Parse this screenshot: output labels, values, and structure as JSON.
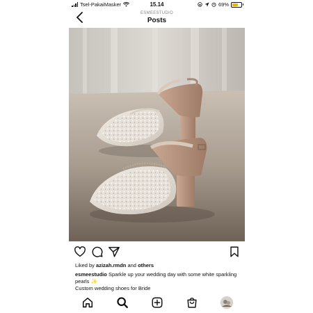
{
  "status_bar": {
    "carrier": "Tsel-PakaiMasker",
    "time": "15.14",
    "battery_percent": "69%",
    "battery_level": 0.69,
    "battery_color": "#f0b400"
  },
  "header": {
    "account": "ESMEESTUDIO",
    "title": "Posts",
    "back_icon": "chevron-left-icon"
  },
  "post": {
    "image_alt_icon": "photo",
    "actions": [
      "heart-icon",
      "comment-icon",
      "share-icon",
      "bookmark-icon"
    ],
    "liked_by_prefix": "Liked by",
    "liked_by_user": "azizah.rmdn",
    "liked_by_and": "and",
    "liked_by_others": "others",
    "caption_user": "esmeestudio",
    "caption_text": "Sparkle up your wedding day with some white sparkling pearls ✨",
    "caption_line2": "Custom wedding shoes for Bride"
  },
  "nav": [
    "home-icon",
    "search-icon",
    "new-post-icon",
    "shop-icon",
    "profile-avatar"
  ]
}
